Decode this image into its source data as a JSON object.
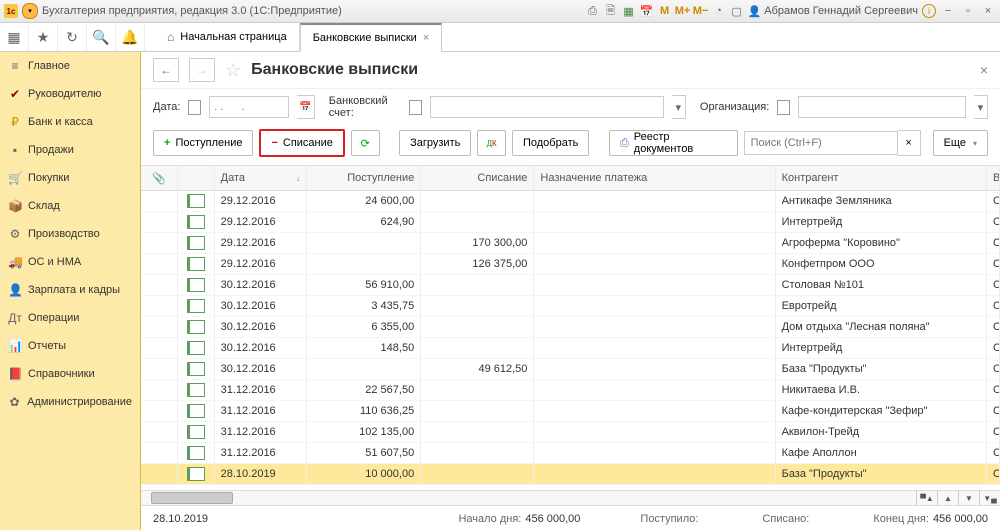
{
  "title": "Бухгалтерия предприятия, редакция 3.0 (1С:Предприятие)",
  "user": "Абрамов Геннадий Сергеевич",
  "tabs": [
    {
      "label": "Начальная страница"
    },
    {
      "label": "Банковские выписки"
    }
  ],
  "sidebar": [
    {
      "icon": "≡",
      "color": "#666",
      "label": "Главное"
    },
    {
      "icon": "✔",
      "color": "#8b0000",
      "label": "Руководителю"
    },
    {
      "icon": "₽",
      "color": "#cc8800",
      "label": "Банк и касса"
    },
    {
      "icon": "▪",
      "color": "#666",
      "label": "Продажи"
    },
    {
      "icon": "🛒",
      "color": "#666",
      "label": "Покупки"
    },
    {
      "icon": "📦",
      "color": "#666",
      "label": "Склад"
    },
    {
      "icon": "⚙",
      "color": "#666",
      "label": "Производство"
    },
    {
      "icon": "🚚",
      "color": "#666",
      "label": "ОС и НМА"
    },
    {
      "icon": "👤",
      "color": "#666",
      "label": "Зарплата и кадры"
    },
    {
      "icon": "Дт",
      "color": "#666",
      "label": "Операции"
    },
    {
      "icon": "📊",
      "color": "#666",
      "label": "Отчеты"
    },
    {
      "icon": "📕",
      "color": "#8b4513",
      "label": "Справочники"
    },
    {
      "icon": "✿",
      "color": "#666",
      "label": "Администрирование"
    }
  ],
  "page": {
    "heading": "Банковские выписки",
    "filters": {
      "date_label": "Дата:",
      "date_placeholder": ". .      .",
      "acct_label": "Банковский счет:",
      "org_label": "Организация:"
    },
    "toolbar": {
      "receipt": "Поступление",
      "writeoff": "Списание",
      "load": "Загрузить",
      "pick": "Подобрать",
      "registry": "Реестр документов",
      "search_placeholder": "Поиск (Ctrl+F)",
      "more": "Еще"
    },
    "columns": {
      "date": "Дата",
      "in": "Поступление",
      "out": "Списание",
      "purpose": "Назначение платежа",
      "agent": "Контрагент",
      "type": "Вид о"
    },
    "rows": [
      {
        "date": "29.12.2016",
        "in": "24 600,00",
        "out": "",
        "agent": "Антикафе Земляника",
        "type": "Оплат"
      },
      {
        "date": "29.12.2016",
        "in": "624,90",
        "out": "",
        "agent": "Интертрейд",
        "type": "Оплат"
      },
      {
        "date": "29.12.2016",
        "in": "",
        "out": "170 300,00",
        "agent": "Агроферма \"Коровино\"",
        "type": "Оплат"
      },
      {
        "date": "29.12.2016",
        "in": "",
        "out": "126 375,00",
        "agent": "Конфетпром ООО",
        "type": "Оплат"
      },
      {
        "date": "30.12.2016",
        "in": "56 910,00",
        "out": "",
        "agent": "Столовая №101",
        "type": "Оплат"
      },
      {
        "date": "30.12.2016",
        "in": "3 435,75",
        "out": "",
        "agent": "Евротрейд",
        "type": "Оплат"
      },
      {
        "date": "30.12.2016",
        "in": "6 355,00",
        "out": "",
        "agent": "Дом отдыха \"Лесная поляна\"",
        "type": "Оплат"
      },
      {
        "date": "30.12.2016",
        "in": "148,50",
        "out": "",
        "agent": "Интертрейд",
        "type": "Оплат"
      },
      {
        "date": "30.12.2016",
        "in": "",
        "out": "49 612,50",
        "agent": "База \"Продукты\"",
        "type": "Оплат"
      },
      {
        "date": "31.12.2016",
        "in": "22 567,50",
        "out": "",
        "agent": "Никитаева И.В.",
        "type": "Оплат"
      },
      {
        "date": "31.12.2016",
        "in": "110 636,25",
        "out": "",
        "agent": "Кафе-кондитерская \"Зефир\"",
        "type": "Оплат"
      },
      {
        "date": "31.12.2016",
        "in": "102 135,00",
        "out": "",
        "agent": "Аквилон-Трейд",
        "type": "Оплат"
      },
      {
        "date": "31.12.2016",
        "in": "51 607,50",
        "out": "",
        "agent": "Кафе Аполлон",
        "type": "Оплат"
      },
      {
        "date": "28.10.2019",
        "in": "10 000,00",
        "out": "",
        "agent": "База \"Продукты\"",
        "type": "Оплат",
        "sel": true
      }
    ],
    "status": {
      "date": "28.10.2019",
      "start_lbl": "Начало дня:",
      "start": "456 000,00",
      "in_lbl": "Поступило:",
      "in_val": "",
      "out_lbl": "Списано:",
      "out_val": "",
      "end_lbl": "Конец дня:",
      "end": "456 000,00"
    }
  }
}
